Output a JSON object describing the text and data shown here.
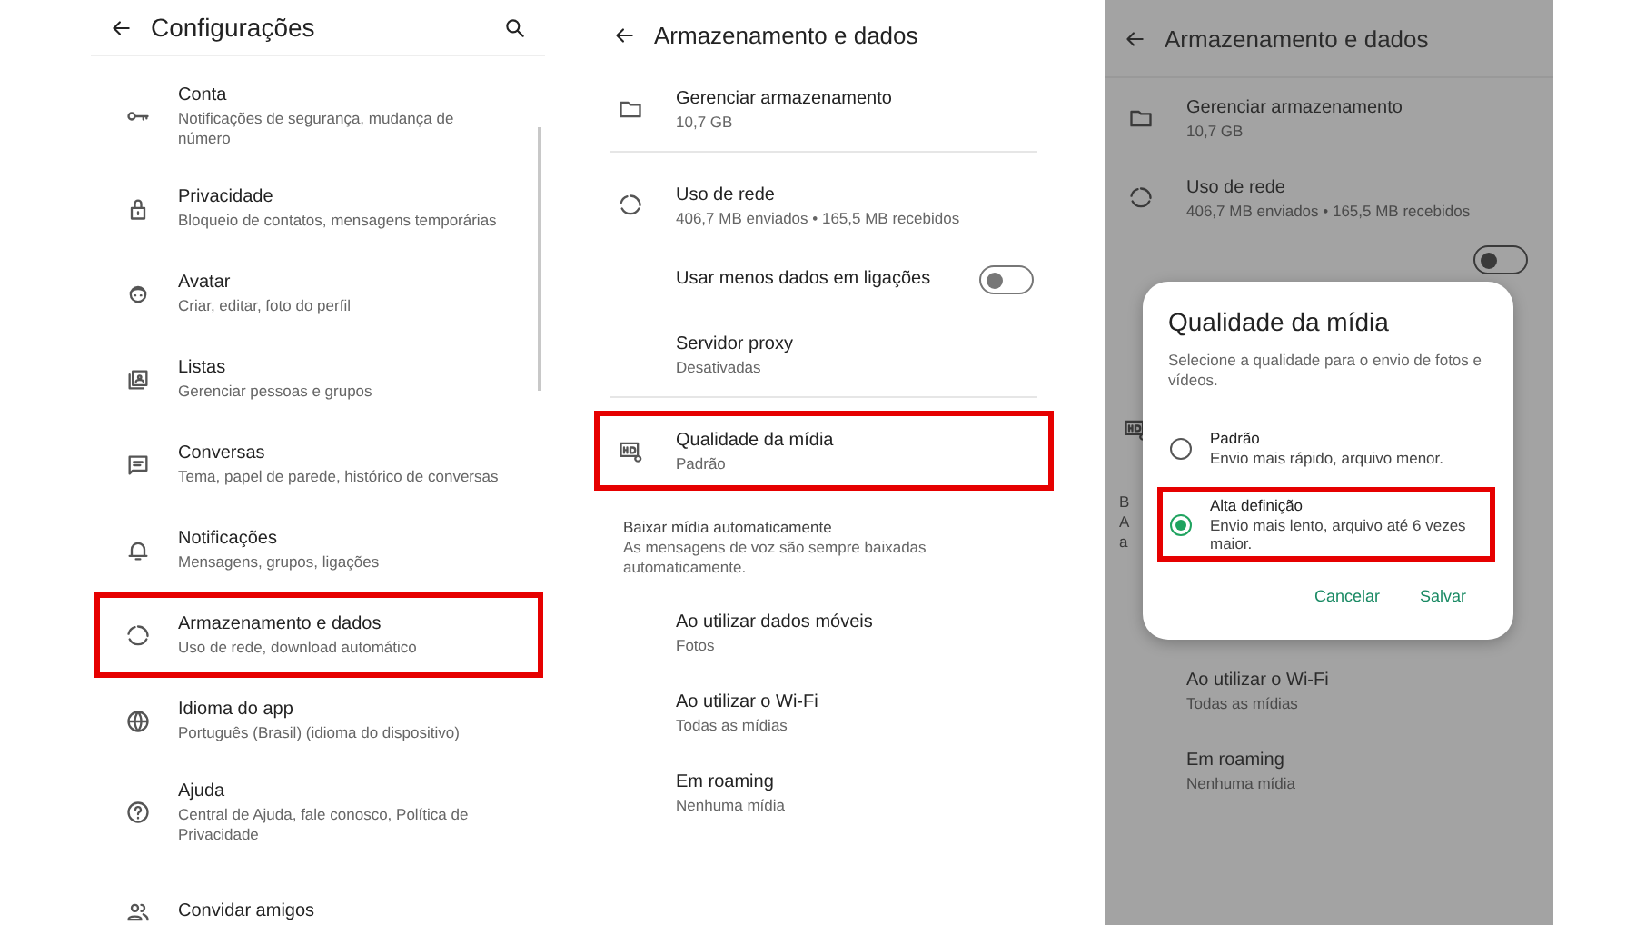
{
  "settings_screen": {
    "title": "Configurações",
    "items": [
      {
        "title": "Conta",
        "subtitle": "Notificações de segurança, mudança de número",
        "highlighted": false
      },
      {
        "title": "Privacidade",
        "subtitle": "Bloqueio de contatos, mensagens temporárias",
        "highlighted": false
      },
      {
        "title": "Avatar",
        "subtitle": "Criar, editar, foto do perfil",
        "highlighted": false
      },
      {
        "title": "Listas",
        "subtitle": "Gerenciar pessoas e grupos",
        "highlighted": false
      },
      {
        "title": "Conversas",
        "subtitle": "Tema, papel de parede, histórico de conversas",
        "highlighted": false
      },
      {
        "title": "Notificações",
        "subtitle": "Mensagens, grupos, ligações",
        "highlighted": false
      },
      {
        "title": "Armazenamento e dados",
        "subtitle": "Uso de rede, download automático",
        "highlighted": true
      },
      {
        "title": "Idioma do app",
        "subtitle": "Português (Brasil) (idioma do dispositivo)",
        "highlighted": false
      },
      {
        "title": "Ajuda",
        "subtitle": "Central de Ajuda, fale conosco, Política de Privacidade",
        "highlighted": false
      },
      {
        "title": "Convidar amigos",
        "highlighted": false
      }
    ]
  },
  "storage_screen": {
    "title": "Armazenamento e dados",
    "items": [
      {
        "kind": "nav",
        "title": "Gerenciar armazenamento",
        "subtitle": "10,7 GB",
        "divider": true,
        "highlighted": false
      },
      {
        "kind": "nav",
        "title": "Uso de rede",
        "subtitle": "406,7 MB enviados • 165,5 MB recebidos",
        "divider": false,
        "highlighted": false
      },
      {
        "kind": "toggle",
        "title": "Usar menos dados em ligações",
        "on": false,
        "divider": false
      },
      {
        "kind": "plain",
        "title": "Servidor proxy",
        "subtitle": "Desativadas",
        "divider": true,
        "highlighted": false
      },
      {
        "kind": "nav",
        "title": "Qualidade da mídia",
        "subtitle": "Padrão",
        "divider": false,
        "highlighted": true
      },
      {
        "kind": "section",
        "title": "Baixar mídia automaticamente",
        "subtitle": "As mensagens de voz são sempre baixadas automaticamente."
      },
      {
        "kind": "plain",
        "title": "Ao utilizar dados móveis",
        "subtitle": "Fotos",
        "divider": false,
        "highlighted": false
      },
      {
        "kind": "plain",
        "title": "Ao utilizar o Wi-Fi",
        "subtitle": "Todas as mídias",
        "divider": false,
        "highlighted": false
      },
      {
        "kind": "plain",
        "title": "Em roaming",
        "subtitle": "Nenhuma mídia",
        "divider": false,
        "highlighted": false
      }
    ]
  },
  "dialog_screen": {
    "title": "Armazenamento e dados",
    "top_items": [
      {
        "title": "Gerenciar armazenamento",
        "subtitle": "10,7 GB"
      },
      {
        "title": "Uso de rede",
        "subtitle": "406,7 MB enviados • 165,5 MB recebidos"
      }
    ],
    "toggle_on": false,
    "fragments": [
      "B",
      "A",
      "a"
    ],
    "bottom_items": [
      {
        "title": "Ao utilizar o Wi-Fi",
        "subtitle": "Todas as mídias"
      },
      {
        "title": "Em roaming",
        "subtitle": "Nenhuma mídia"
      }
    ],
    "dialog": {
      "title": "Qualidade da mídia",
      "description": "Selecione a qualidade para o envio de fotos e vídeos.",
      "options": [
        {
          "label": "Padrão",
          "description": "Envio mais rápido, arquivo menor.",
          "selected": false,
          "highlighted": false
        },
        {
          "label": "Alta definição",
          "description": "Envio mais lento, arquivo até 6 vezes maior.",
          "selected": true,
          "highlighted": true
        }
      ],
      "buttons": [
        "Cancelar",
        "Salvar"
      ]
    }
  }
}
